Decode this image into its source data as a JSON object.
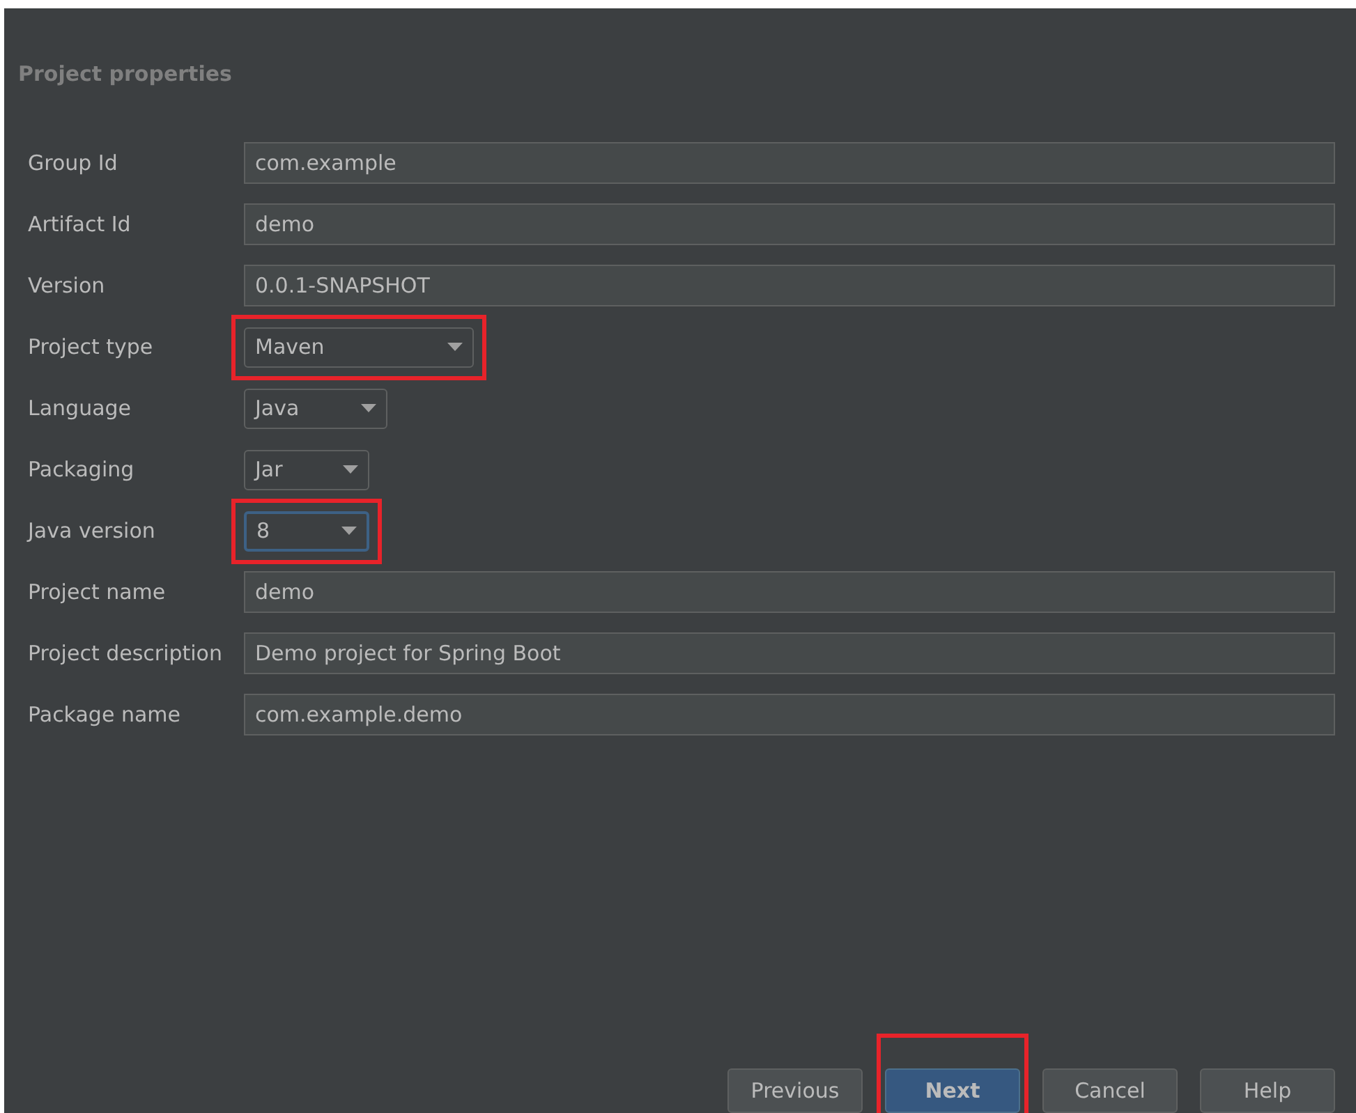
{
  "section_title": "Project properties",
  "fields": [
    {
      "label": "Group Id",
      "kind": "text",
      "value": "com.example",
      "focused": false,
      "annotated": false
    },
    {
      "label": "Artifact Id",
      "kind": "text",
      "value": "demo",
      "focused": false,
      "annotated": false
    },
    {
      "label": "Version",
      "kind": "text",
      "value": "0.0.1-SNAPSHOT",
      "focused": false,
      "annotated": false
    },
    {
      "label": "Project type",
      "kind": "dropdown",
      "value": "Maven",
      "focused": false,
      "annotated": true
    },
    {
      "label": "Language",
      "kind": "dropdown",
      "value": "Java",
      "focused": false,
      "annotated": false
    },
    {
      "label": "Packaging",
      "kind": "dropdown",
      "value": "Jar",
      "focused": false,
      "annotated": false
    },
    {
      "label": "Java version",
      "kind": "dropdown",
      "value": "8",
      "focused": true,
      "annotated": true
    },
    {
      "label": "Project name",
      "kind": "text",
      "value": "demo",
      "focused": false,
      "annotated": false
    },
    {
      "label": "Project description",
      "kind": "text",
      "value": "Demo project for Spring Boot",
      "focused": false,
      "annotated": false
    },
    {
      "label": "Package name",
      "kind": "text",
      "value": "com.example.demo",
      "focused": false,
      "annotated": false
    }
  ],
  "buttons": [
    {
      "label": "Previous",
      "default": false,
      "annotated": false
    },
    {
      "label": "Next",
      "default": true,
      "annotated": true
    },
    {
      "label": "Cancel",
      "default": false,
      "annotated": false
    },
    {
      "label": "Help",
      "default": false,
      "annotated": false
    }
  ]
}
